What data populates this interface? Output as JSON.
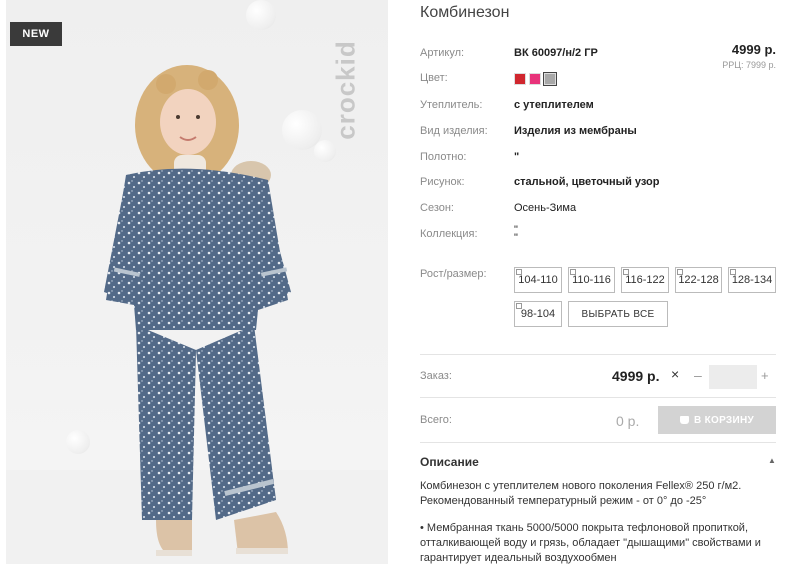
{
  "product": {
    "badge": "NEW",
    "brand_watermark": "crockid",
    "title": "Комбинезон"
  },
  "attributes": [
    {
      "label": "Артикул:",
      "value": "ВК 60097/н/2 ГР"
    },
    {
      "label": "Цвет:",
      "value": ""
    },
    {
      "label": "Утеплитель:",
      "value": "с утеплителем"
    },
    {
      "label": "Вид изделия:",
      "value": "Изделия из мембраны"
    },
    {
      "label": "Полотно:",
      "value": "\""
    },
    {
      "label": "Рисунок:",
      "value": "стальной, цветочный узор"
    },
    {
      "label": "Сезон:",
      "value": "Осень-Зима"
    },
    {
      "label": "Коллекция:",
      "value": "\"\n\""
    }
  ],
  "price": {
    "current": "4999 р.",
    "rrp": "РРЦ: 7999 р."
  },
  "colors": [
    {
      "name": "red",
      "hex": "#d0262e",
      "selected": false
    },
    {
      "name": "pink",
      "hex": "#e8337a",
      "selected": false
    },
    {
      "name": "grey",
      "hex": "#a8a8a8",
      "selected": true
    }
  ],
  "sizes": {
    "label": "Рост/размер:",
    "options": [
      "104-110",
      "110-116",
      "116-122",
      "122-128",
      "128-134",
      "98-104"
    ],
    "select_all": "ВЫБРАТЬ ВСЕ"
  },
  "order": {
    "label": "Заказ:",
    "price": "4999 р.",
    "times": "×",
    "minus": "–",
    "plus": "+",
    "qty": ""
  },
  "total": {
    "label": "Всего:",
    "value": "0 р.",
    "cart_button": "В КОРЗИНУ"
  },
  "description": {
    "heading": "Описание",
    "arrow": "▲",
    "line1": "Комбинезон с утеплителем нового поколения Fellex® 250 г/м2.",
    "line2": "Рекомендованный температурный режим - от 0° до -25°",
    "line3": "• Мембранная ткань 5000/5000 покрыта тефлоновой пропиткой,",
    "line4": "отталкивающей воду и грязь, обладает \"дышащими\" свойствами и",
    "line5": "гарантирует идеальный воздухообмен"
  }
}
